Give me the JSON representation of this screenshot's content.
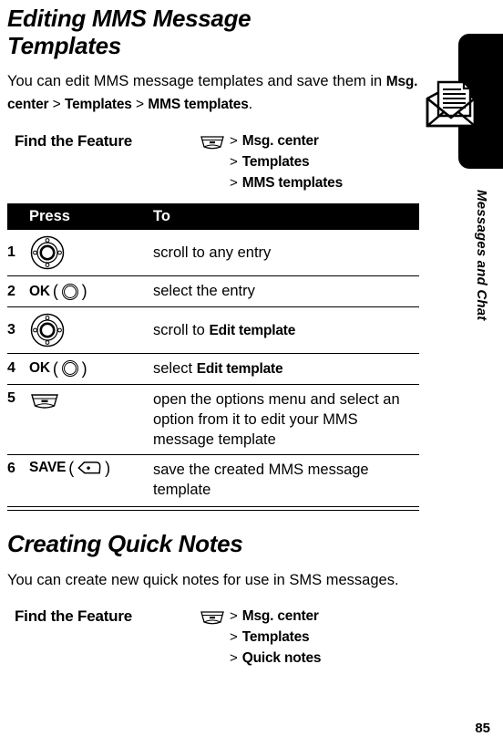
{
  "page": {
    "number": "85",
    "side_label": "Messages and Chat",
    "side_icon": "envelope-message-icon"
  },
  "sections": [
    {
      "title": "Editing MMS Message Templates",
      "intro_prefix": "You can edit MMS message templates and save them in ",
      "intro_path": [
        "Msg. center",
        "Templates",
        "MMS templates"
      ],
      "intro_suffix": ".",
      "find_the_feature": {
        "label": "Find the Feature",
        "key_icon": "menu-key-icon",
        "arrow": ">",
        "path": [
          "Msg. center",
          "Templates",
          "MMS templates"
        ]
      },
      "table": {
        "headers": [
          "",
          "Press",
          "To"
        ],
        "rows": [
          {
            "num": "1",
            "press_label": "",
            "press_icon": "navigation-key-icon",
            "to_prefix": "scroll to any entry",
            "to_bold": "",
            "to_suffix": ""
          },
          {
            "num": "2",
            "press_label": "OK",
            "press_icon": "center-select-key-icon",
            "to_prefix": "select the entry",
            "to_bold": "",
            "to_suffix": ""
          },
          {
            "num": "3",
            "press_label": "",
            "press_icon": "navigation-key-icon",
            "to_prefix": "scroll to ",
            "to_bold": "Edit template",
            "to_suffix": ""
          },
          {
            "num": "4",
            "press_label": "OK",
            "press_icon": "center-select-key-icon",
            "to_prefix": "select ",
            "to_bold": "Edit template",
            "to_suffix": ""
          },
          {
            "num": "5",
            "press_label": "",
            "press_icon": "menu-key-icon",
            "to_prefix": "open the options menu and select an option from it to edit your MMS message template",
            "to_bold": "",
            "to_suffix": ""
          },
          {
            "num": "6",
            "press_label": "SAVE",
            "press_icon": "soft-key-icon",
            "to_prefix": "save the created MMS message template",
            "to_bold": "",
            "to_suffix": ""
          }
        ]
      }
    },
    {
      "title": "Creating Quick Notes",
      "intro_prefix": "You can create new quick notes for use in SMS messages.",
      "find_the_feature": {
        "label": "Find the Feature",
        "key_icon": "menu-key-icon",
        "arrow": ">",
        "path": [
          "Msg. center",
          "Templates",
          "Quick notes"
        ]
      }
    }
  ],
  "colors": {
    "ink": "#000000",
    "paper": "#ffffff",
    "header_bar": "#000000",
    "header_text": "#ffffff"
  }
}
